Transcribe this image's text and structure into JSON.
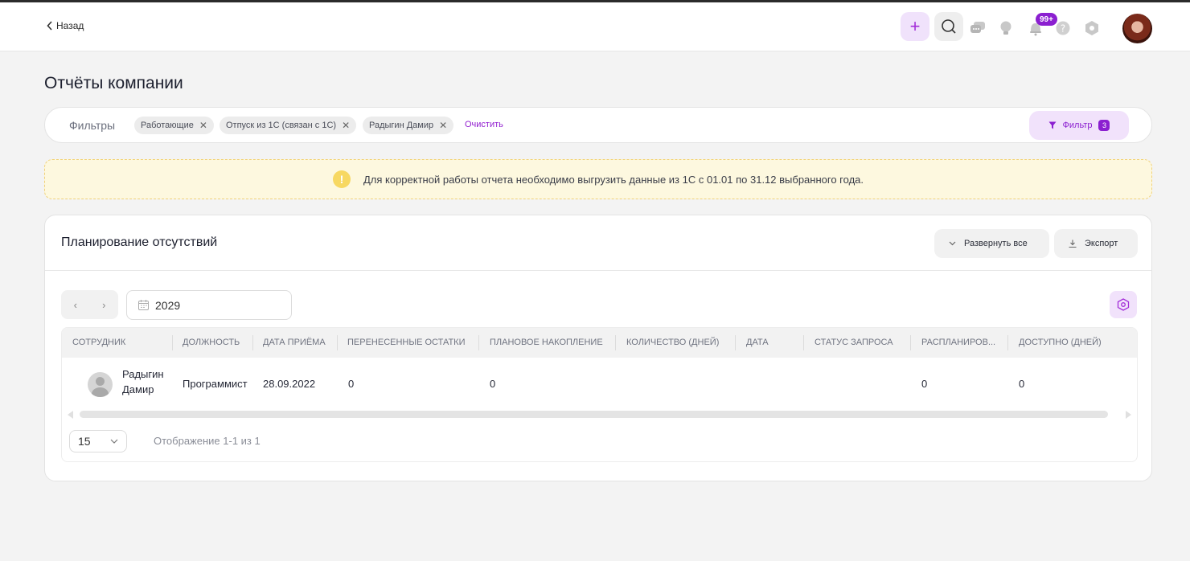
{
  "header": {
    "back_label": "Назад",
    "notifications_badge": "99+"
  },
  "page_title": "Отчёты компании",
  "filters": {
    "label": "Фильтры",
    "chips": [
      "Работающие",
      "Отпуск из 1С (связан с 1С)",
      "Радыгин Дамир"
    ],
    "clear_label": "Очистить",
    "button_label": "Фильтр",
    "count": "3"
  },
  "warning": {
    "icon": "!",
    "text": "Для корректной работы отчета необходимо выгрузить данные из 1С с 01.01 по 31.12 выбранного года."
  },
  "report": {
    "title": "Планирование отсутствий",
    "expand_label": "Развернуть все",
    "export_label": "Экспорт",
    "year": "2029",
    "columns": [
      "Сотрудник",
      "Должность",
      "Дата приёма",
      "Перенесенные остатки",
      "Плановое накопление",
      "Количество (дней)",
      "Дата",
      "Статус запроса",
      "Распланиров...",
      "Доступно (дней)"
    ],
    "rows": [
      {
        "name_line1": "Радыгин",
        "name_line2": "Дамир",
        "position": "Программист",
        "hire_date": "28.09.2022",
        "carried_over": "0",
        "planned_accrual": "0",
        "count_days": "",
        "date": "",
        "status": "",
        "planned": "0",
        "available": "0"
      }
    ],
    "page_size": "15",
    "pager_text": "Отображение 1-1 из 1"
  },
  "colors": {
    "accent": "#8b1fd0",
    "accent_light": "#f1e2fb",
    "warning_bg": "#fdf8df"
  }
}
